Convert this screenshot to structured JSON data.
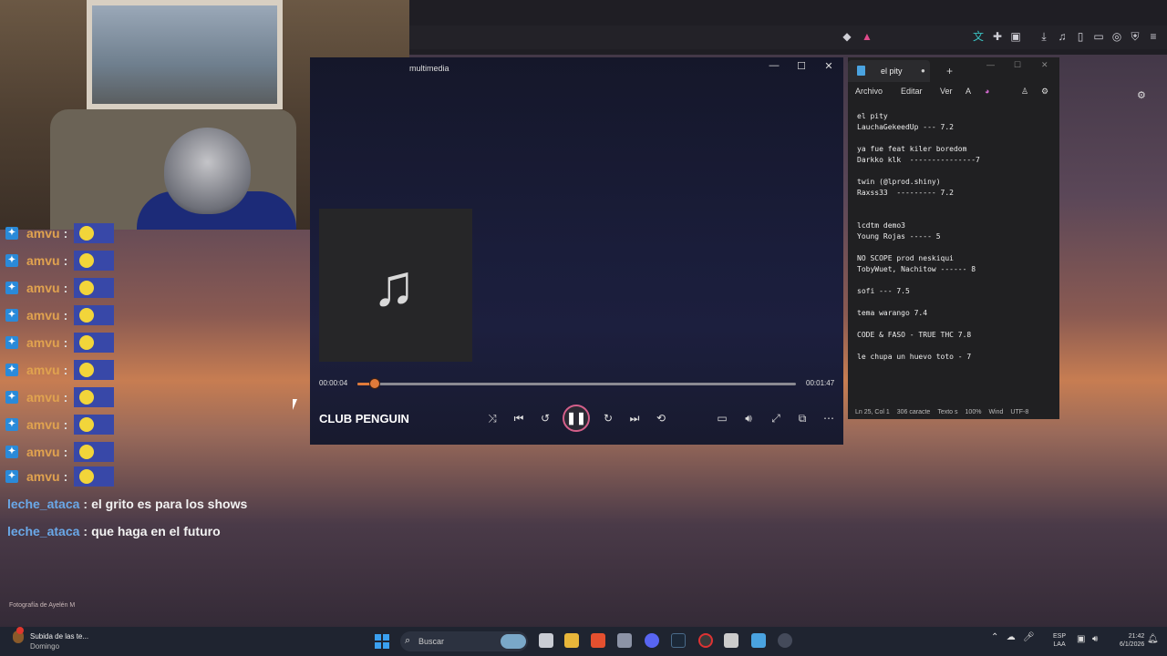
{
  "chat": {
    "repeat_user": "amvu",
    "repeat_sep": ":",
    "messages": [
      {
        "user": "leche_ataca",
        "sep": ":",
        "text": "el grito es para los shows"
      },
      {
        "user": "leche_ataca",
        "sep": ":",
        "text": "que haga en el futuro"
      }
    ],
    "photo_credit": "Fotografía de Ayelén M"
  },
  "player": {
    "window_title": "multimedia",
    "time_current": "00:00:04",
    "time_total": "00:01:47",
    "progress_fraction": 0.04,
    "track_title": "CLUB PENGUIN",
    "album_icon": "music-note-icon",
    "accent": "#e07a3a"
  },
  "notepad": {
    "tab_label": "el pity",
    "menu": [
      "Archivo",
      "Editar",
      "Ver"
    ],
    "lines": [
      "el pity",
      "LauchaGekeedUp --- 7.2",
      "",
      "ya fue feat kiler boredom",
      "Darkko klk  ---------------7",
      "",
      "twin (@lprod.shiny)",
      "Raxss33  --------- 7.2",
      "",
      "",
      "lcdtm demo3",
      "Young Rojas ----- 5",
      "",
      "NO SCOPE prod neskiqui",
      "TobyWuet, Nachitow ------ 8",
      "",
      "sofi --- 7.5",
      "",
      "tema warango 7.4",
      "",
      "CODE & FASO - TRUE THC 7.8",
      "",
      "le chupa un huevo toto - 7"
    ],
    "status": {
      "position": "Ln 25, Col 1",
      "chars": "306 caracte",
      "format": "Texto s",
      "zoom": "100%",
      "eol": "Wind",
      "encoding": "UTF-8"
    }
  },
  "taskbar": {
    "notification_title": "Subida de las te...",
    "notification_sub": "Domingo",
    "search_label": "Buscar",
    "lang_top": "ESP",
    "lang_bottom": "LAA",
    "time": "21:42",
    "date": "6/1/2026"
  }
}
